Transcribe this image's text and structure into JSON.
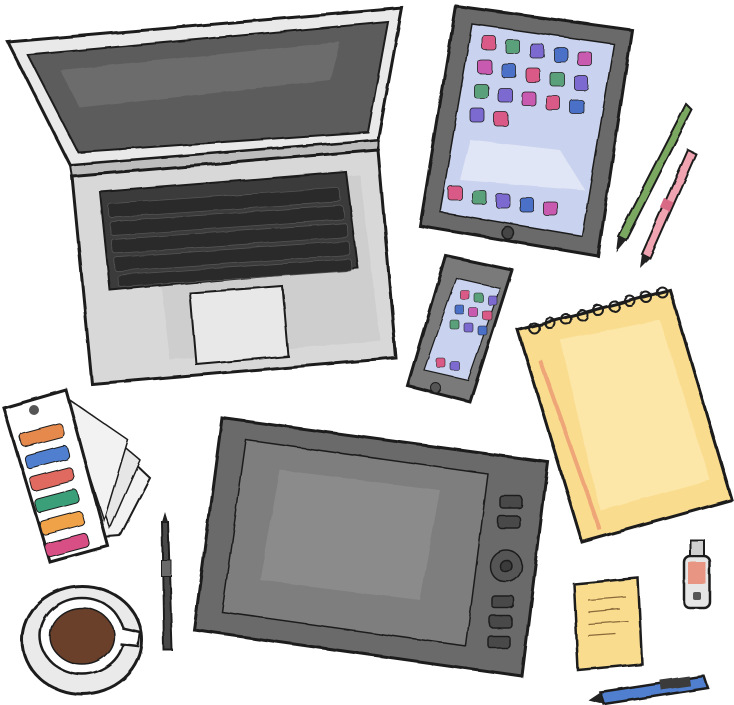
{
  "illustration": {
    "style": "watercolor-sketch",
    "background": "#ffffff",
    "objects": [
      "laptop-icon",
      "tablet-icon",
      "smartphone-icon",
      "pencil-icon",
      "notepad-icon",
      "color-swatch-fan-icon",
      "graphics-tablet-icon",
      "stylus-icon",
      "coffee-cup-icon",
      "sticky-note-icon",
      "usb-drive-icon",
      "pen-icon"
    ],
    "palette": {
      "ink": "#1f1f1f",
      "laptop_gray": "#8a8a8a",
      "screen_dark": "#5c5c5c",
      "tablet_screen": "#c9d2ee",
      "notepad_yellow": "#f9dc8e",
      "coffee": "#6b3f2a",
      "swatch_colors": [
        "#e6894d",
        "#4f7fce",
        "#e06b5e",
        "#3aa07a",
        "#f0a24a",
        "#d84f86"
      ],
      "app_colors": [
        "#d95a86",
        "#5aa07a",
        "#7b6ad0",
        "#4b6fc8",
        "#c85ab0"
      ]
    }
  }
}
